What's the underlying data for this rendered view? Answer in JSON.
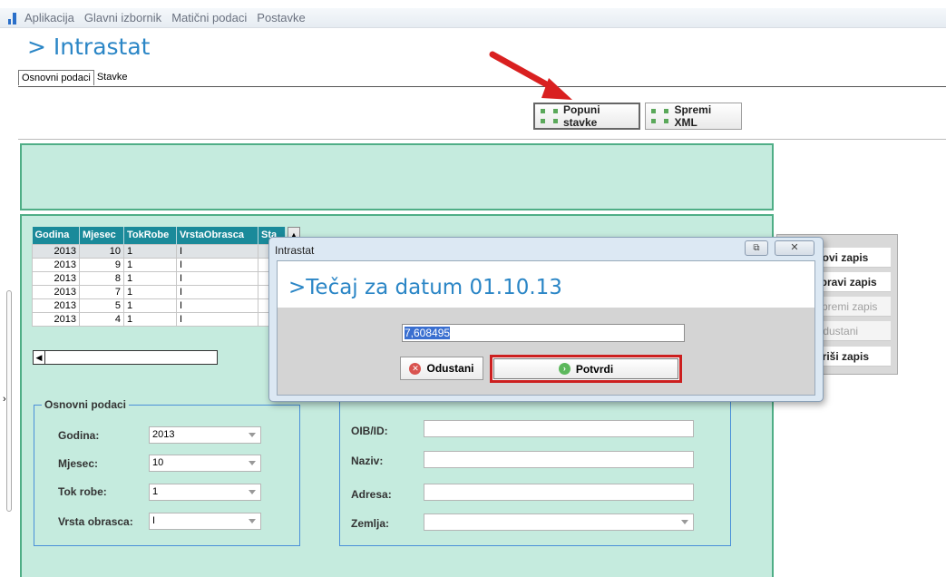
{
  "menu": [
    "Aplikacija",
    "Glavni izbornik",
    "Matični podaci",
    "Postavke"
  ],
  "page_title": "> Intrastat",
  "tabs": [
    "Osnovni podaci",
    "Stavke"
  ],
  "toolbar": {
    "popuni_label": "Popuni stavke",
    "spremi_label": "Spremi XML"
  },
  "grid": {
    "headers": [
      "Godina",
      "Mjesec",
      "TokRobe",
      "VrstaObrasca",
      "Sta"
    ],
    "rows": [
      [
        "2013",
        "10",
        "1",
        "I"
      ],
      [
        "2013",
        "9",
        "1",
        "I"
      ],
      [
        "2013",
        "8",
        "1",
        "I"
      ],
      [
        "2013",
        "7",
        "1",
        "I"
      ],
      [
        "2013",
        "5",
        "1",
        "I"
      ],
      [
        "2013",
        "4",
        "1",
        "I"
      ]
    ]
  },
  "form": {
    "legend": "Osnovni podaci",
    "godina_label": "Godina:",
    "godina_value": "2013",
    "mjesec_label": "Mjesec:",
    "mjesec_value": "10",
    "tok_label": "Tok robe:",
    "tok_value": "1",
    "vrsta_label": "Vrsta obrasca:",
    "vrsta_value": "I",
    "oib_label": "OIB/ID:",
    "naziv_label": "Naziv:",
    "adresa_label": "Adresa:",
    "zemlja_label": "Zemlja:"
  },
  "actions": [
    "Novi zapis",
    "Ispravi zapis",
    "Spremi zapis",
    "Odustani",
    "Briši zapis"
  ],
  "actions_visible": [
    "Novi zapis",
    "spravi zapis",
    "Spremi zapis",
    "Odustani",
    "Briši zapis"
  ],
  "modal": {
    "title": "Intrastat",
    "heading": ">Tečaj za datum 01.10.13",
    "rate_value": "7,608495",
    "cancel_label": "Odustani",
    "confirm_label": "Potvrdi",
    "close_glyph": "✕",
    "restore_glyph": "⧉"
  },
  "colors": {
    "accent": "#2b86c6",
    "panel": "#c5ebde",
    "panel_border": "#4fae86",
    "highlight": "#cc1f1f",
    "grid_header": "#1a8a9a"
  }
}
